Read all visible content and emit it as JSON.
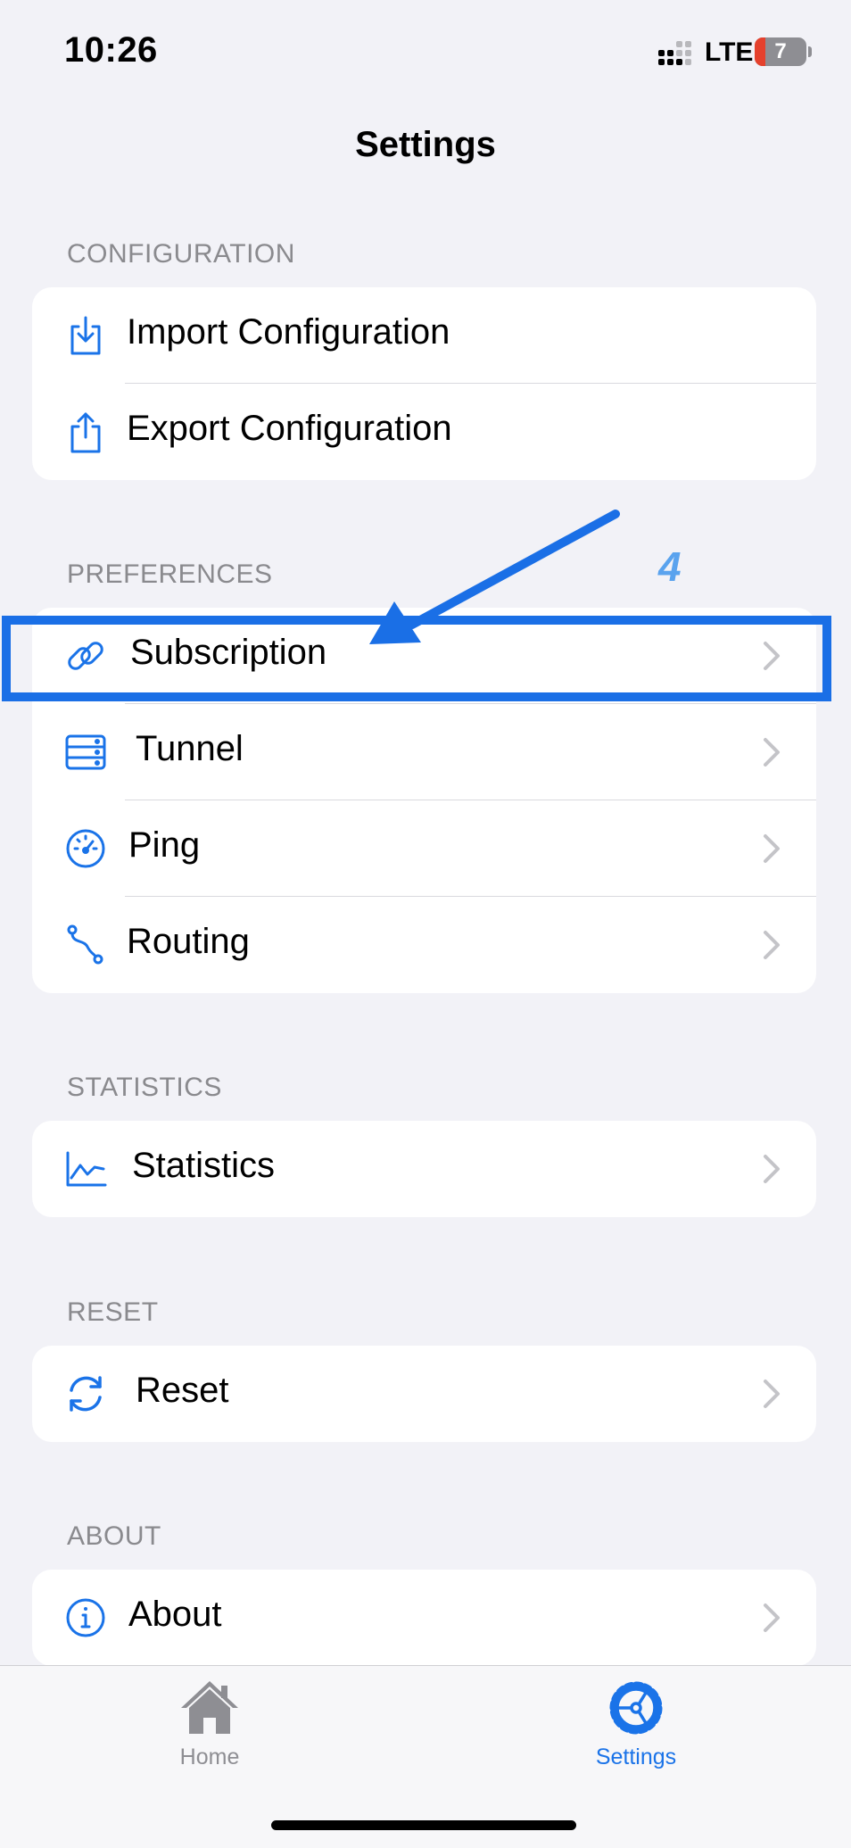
{
  "status": {
    "time": "10:26",
    "network": "LTE",
    "battery": "7"
  },
  "nav": {
    "title": "Settings"
  },
  "sections": {
    "configuration": {
      "header": "CONFIGURATION",
      "items": [
        {
          "label": "Import Configuration",
          "icon": "import-icon"
        },
        {
          "label": "Export Configuration",
          "icon": "export-icon"
        }
      ]
    },
    "preferences": {
      "header": "PREFERENCES",
      "items": [
        {
          "label": "Subscription",
          "icon": "link-icon"
        },
        {
          "label": "Tunnel",
          "icon": "server-icon"
        },
        {
          "label": "Ping",
          "icon": "speedometer-icon"
        },
        {
          "label": "Routing",
          "icon": "route-icon"
        }
      ]
    },
    "statistics": {
      "header": "STATISTICS",
      "items": [
        {
          "label": "Statistics",
          "icon": "chart-icon"
        }
      ]
    },
    "reset": {
      "header": "RESET",
      "items": [
        {
          "label": "Reset",
          "icon": "refresh-icon"
        }
      ]
    },
    "about": {
      "header": "ABOUT",
      "items": [
        {
          "label": "About",
          "icon": "info-icon"
        }
      ]
    }
  },
  "tabs": [
    {
      "label": "Home",
      "icon": "house-icon",
      "active": false
    },
    {
      "label": "Settings",
      "icon": "gear-icon",
      "active": true
    }
  ],
  "annotation": {
    "step": "4"
  },
  "colors": {
    "accent": "#1a73e8",
    "annotation": "#1a6fe6",
    "background": "#f2f2f7"
  }
}
